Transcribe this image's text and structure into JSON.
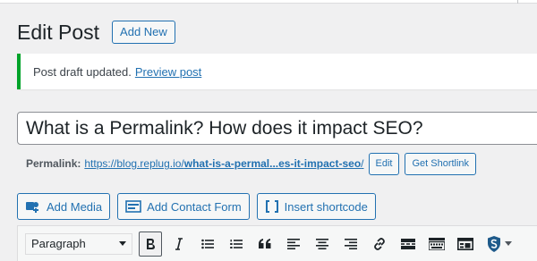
{
  "page": {
    "title": "Edit Post",
    "add_new_label": "Add New"
  },
  "notice": {
    "text": "Post draft updated.",
    "link_label": "Preview post",
    "accent_color": "#00a32a"
  },
  "post": {
    "title_value": "What is a Permalink? How does it impact SEO?"
  },
  "permalink": {
    "label": "Permalink:",
    "url_base": "https://blog.replug.io/",
    "url_slug": "what-is-a-permal...es-it-impact-seo",
    "url_trailing": "/",
    "edit_label": "Edit",
    "shortlink_label": "Get Shortlink"
  },
  "media_buttons": {
    "add_media": "Add Media",
    "add_contact_form": "Add Contact Form",
    "insert_shortcode": "Insert shortcode"
  },
  "toolbar": {
    "format_selected": "Paragraph",
    "items": [
      {
        "name": "bold-icon",
        "active": true
      },
      {
        "name": "italic-icon"
      },
      {
        "name": "bulleted-list-icon"
      },
      {
        "name": "numbered-list-icon"
      },
      {
        "name": "blockquote-icon"
      },
      {
        "name": "align-left-icon"
      },
      {
        "name": "align-center-icon"
      },
      {
        "name": "align-right-icon"
      },
      {
        "name": "insert-link-icon"
      },
      {
        "name": "read-more-icon"
      },
      {
        "name": "toolbar-toggle-icon"
      },
      {
        "name": "form-icon"
      },
      {
        "name": "shield-s-icon"
      },
      {
        "name": "chevron-down-icon"
      }
    ]
  },
  "colors": {
    "accent": "#2271b1",
    "background": "#f0f0f1",
    "text": "#1d2327"
  }
}
